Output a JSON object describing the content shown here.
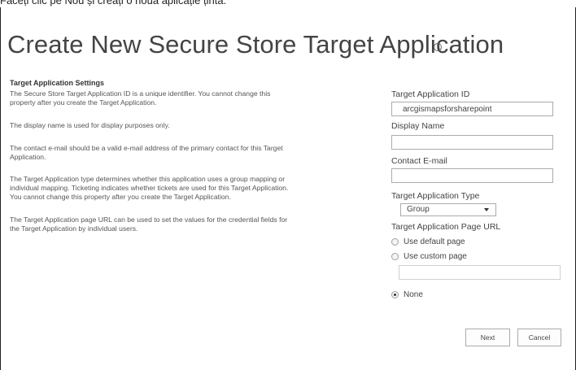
{
  "caption": "Faceți clic pe Nou și creați o nouă aplicație țintă.",
  "page": {
    "title": "Create New Secure Store Target Application",
    "info_icon": "info-icon"
  },
  "descriptions": {
    "heading": "Target Application Settings",
    "id_line1": "The Secure Store Target Application ID is a unique identifier. You cannot change this",
    "id_line2": "property after you create the Target Application.",
    "display_name": "The display name is used for display purposes only.",
    "contact_line1": "The contact e-mail should be a valid e-mail address of the primary contact for this Target",
    "contact_line2": "Application.",
    "type_line1": "The Target Application type determines whether this application uses a group mapping or",
    "type_line2": "individual mapping. Ticketing indicates whether tickets are used for this Target Application.",
    "type_line3": "You cannot change this property after you create the Target Application.",
    "url_line1": "The Target Application page URL can be used to set the values for the credential fields for",
    "url_line2": "the Target Application by individual users."
  },
  "form": {
    "app_id_label": "Target Application ID",
    "app_id_value": "arcgismapsforsharepoint",
    "display_name_label": "Display Name",
    "display_name_value": "",
    "contact_label": "Contact E-mail",
    "contact_value": "",
    "type_label": "Target Application Type",
    "type_selected": "Group",
    "page_url_label": "Target Application Page URL",
    "radio_default": "Use default page",
    "radio_custom": "Use custom page",
    "radio_none": "None",
    "custom_url_value": "",
    "selected_radio": "None"
  },
  "buttons": {
    "next": "Next",
    "cancel": "Cancel"
  },
  "colors": {
    "title_text": "#444444",
    "border": "#ababab"
  }
}
